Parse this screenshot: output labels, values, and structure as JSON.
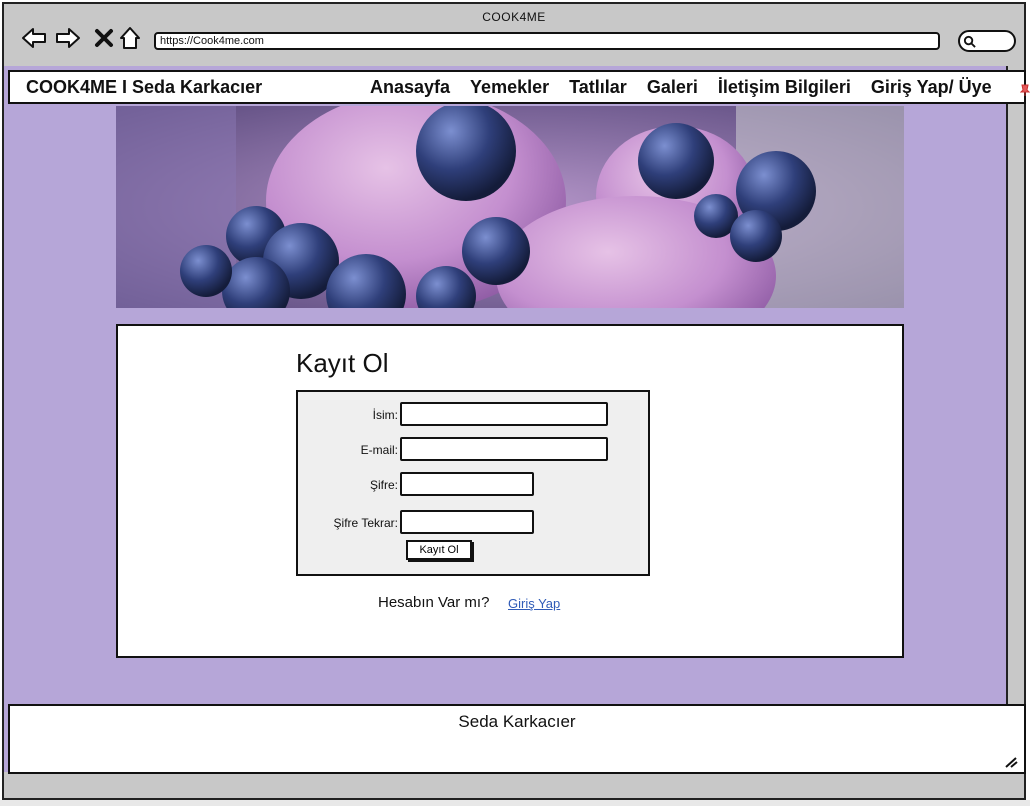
{
  "window": {
    "title": "COOK4ME",
    "url": "https://Cook4me.com"
  },
  "navbar": {
    "brand": "COOK4ME I Seda Karkacıer",
    "links": [
      "Anasayfa",
      "Yemekler",
      "Tatlılar",
      "Galeri",
      "İletişim Bilgileri",
      "Giriş Yap/ Üye"
    ]
  },
  "hero": {
    "image_alt_icon": "blueberry-ice-cream-image"
  },
  "form": {
    "title": "Kayıt Ol",
    "fields": [
      {
        "label": "İsim:",
        "value": ""
      },
      {
        "label": "E-mail:",
        "value": ""
      },
      {
        "label": "Şifre:",
        "value": ""
      },
      {
        "label": "Şifre Tekrar:",
        "value": ""
      }
    ],
    "submit_label": "Kayıt Ol",
    "have_account_text": "Hesabın Var mı?",
    "login_link": "Giriş Yap"
  },
  "footer": {
    "text": "Seda Karkacıer"
  },
  "colors": {
    "page_bg": "#b6a6d8",
    "chrome": "#c8c8c8",
    "form_box": "#efefef",
    "link": "#2f5bb7"
  }
}
